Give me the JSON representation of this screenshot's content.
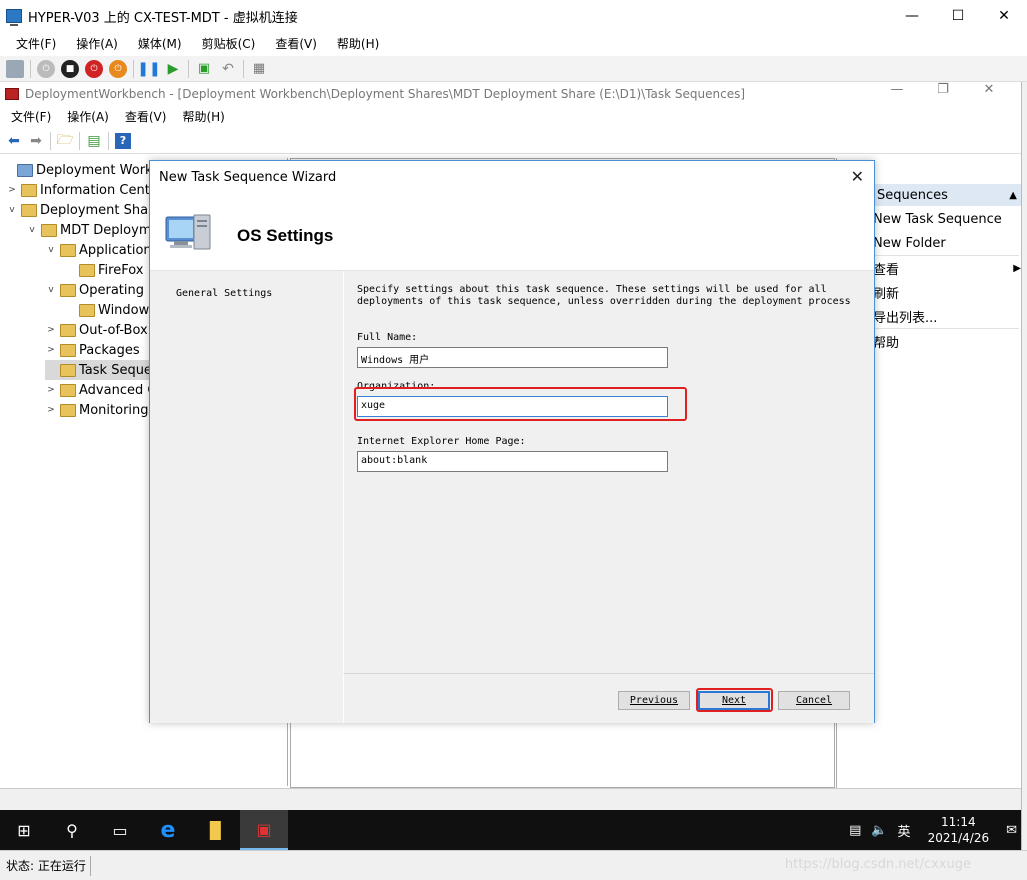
{
  "vm": {
    "title": "HYPER-V03 上的 CX-TEST-MDT - 虚拟机连接",
    "menu": [
      "文件(F)",
      "操作(A)",
      "媒体(M)",
      "剪贴板(C)",
      "查看(V)",
      "帮助(H)"
    ],
    "status": "状态: 正在运行"
  },
  "mmc": {
    "title": "DeploymentWorkbench - [Deployment Workbench\\Deployment Shares\\MDT Deployment Share (E:\\D1)\\Task Sequences]",
    "menu": [
      "文件(F)",
      "操作(A)",
      "查看(V)",
      "帮助(H)"
    ]
  },
  "tree": {
    "items": [
      {
        "label": "Deployment Workbe",
        "arrow": ""
      },
      {
        "label": "Information Cente",
        "arrow": ">"
      },
      {
        "label": "Deployment Share",
        "arrow": "v"
      },
      {
        "label": "MDT Deploym",
        "arrow": "v"
      },
      {
        "label": "Application",
        "arrow": "v"
      },
      {
        "label": "FireFox",
        "arrow": ""
      },
      {
        "label": "Operating S",
        "arrow": "v"
      },
      {
        "label": "Window",
        "arrow": ""
      },
      {
        "label": "Out-of-Box",
        "arrow": ">"
      },
      {
        "label": "Packages",
        "arrow": ">"
      },
      {
        "label": "Task Seque",
        "arrow": ""
      },
      {
        "label": "Advanced C",
        "arrow": ">"
      },
      {
        "label": "Monitoring",
        "arrow": ">"
      }
    ]
  },
  "actions": {
    "header": "Sequences",
    "items": [
      "New Task Sequence",
      "New Folder",
      "查看",
      "刷新",
      "导出列表...",
      "帮助"
    ]
  },
  "dialog": {
    "title": "New Task Sequence Wizard",
    "heading": "OS Settings",
    "nav_item": "General Settings",
    "description": "Specify settings about this task sequence.  These settings will be used for all deployments of this task sequence, unless overridden during the deployment process",
    "full_name_label": "Full Name:",
    "full_name_value": "Windows 用户",
    "organization_label": "Organization:",
    "organization_value": "xuge",
    "ie_home_label": "Internet Explorer Home Page:",
    "ie_home_value": "about:blank",
    "previous_label": "Previous",
    "next_label": "Next",
    "cancel_label": "Cancel"
  },
  "taskbar": {
    "ime": "英",
    "time": "11:14",
    "date": "2021/4/26"
  },
  "watermark": "https://blog.csdn.net/cxxuge",
  "colors": {
    "highlight": "#e02020",
    "accent": "#2b77d1",
    "taskbar": "#101010"
  }
}
